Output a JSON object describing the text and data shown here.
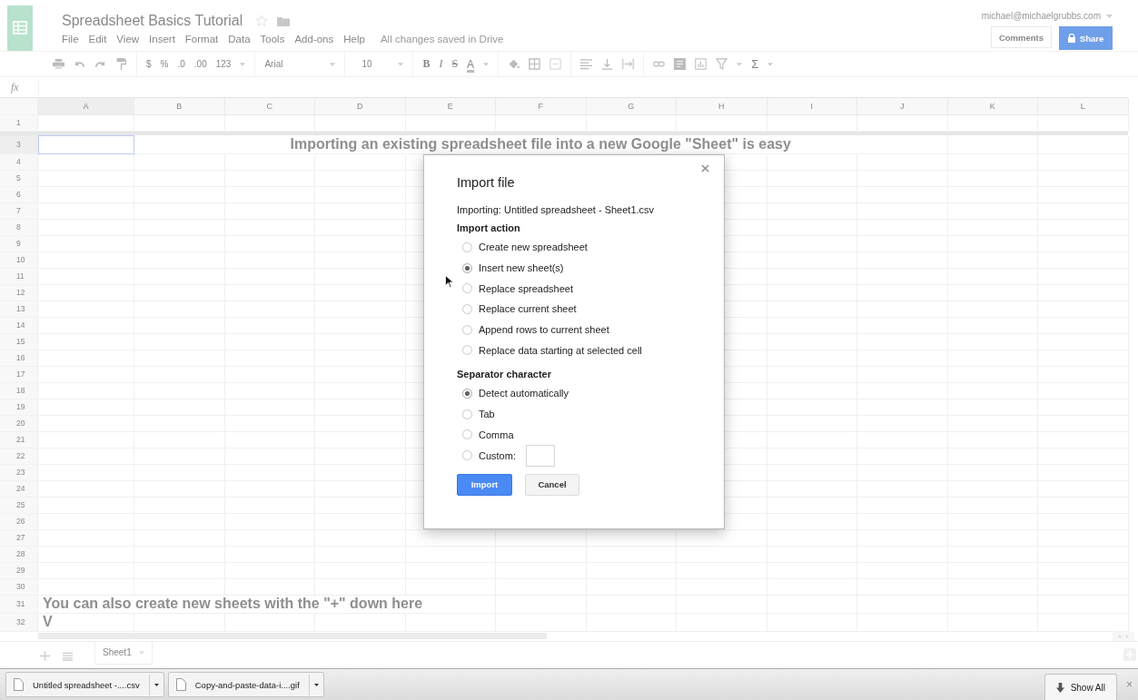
{
  "document": {
    "title": "Spreadsheet Basics Tutorial",
    "menu": [
      "File",
      "Edit",
      "View",
      "Insert",
      "Format",
      "Data",
      "Tools",
      "Add-ons",
      "Help"
    ],
    "save_status": "All changes saved in Drive",
    "account": "michael@michaelgrubbs.com",
    "buttons": [
      "Comments",
      "Share"
    ]
  },
  "toolbar": {
    "number_formats": [
      "$",
      "%",
      ".0",
      ".00",
      "123"
    ],
    "font": "Arial",
    "font_size": "10",
    "text_styles": [
      "B",
      "I",
      "S",
      "A"
    ],
    "function": "Σ"
  },
  "formula_bar": {
    "label": "fx"
  },
  "grid": {
    "columns": [
      {
        "label": "A",
        "selected": true
      },
      {
        "label": "B",
        "selected": false
      },
      {
        "label": "C",
        "selected": false
      },
      {
        "label": "D",
        "selected": false
      },
      {
        "label": "E",
        "selected": false
      },
      {
        "label": "F",
        "selected": false
      },
      {
        "label": "G",
        "selected": false
      },
      {
        "label": "H",
        "selected": false
      },
      {
        "label": "I",
        "selected": false
      },
      {
        "label": "J",
        "selected": false
      },
      {
        "label": "K",
        "selected": false
      },
      {
        "label": "L",
        "selected": false
      }
    ],
    "rows": [
      {
        "number": "1",
        "selected": false,
        "frozen": true
      },
      {
        "number": "3",
        "selected": true,
        "frozen": false,
        "kind": "banner",
        "text": "Importing an existing spreadsheet file into a new Google \"Sheet\" is easy"
      },
      {
        "number": "4",
        "selected": false,
        "frozen": false
      },
      {
        "number": "5",
        "selected": false,
        "frozen": false
      },
      {
        "number": "6",
        "selected": false,
        "frozen": false
      },
      {
        "number": "7",
        "selected": false,
        "frozen": false
      },
      {
        "number": "8",
        "selected": false,
        "frozen": false
      },
      {
        "number": "9",
        "selected": false,
        "frozen": false
      },
      {
        "number": "10",
        "selected": false,
        "frozen": false
      },
      {
        "number": "11",
        "selected": false,
        "frozen": false
      },
      {
        "number": "12",
        "selected": false,
        "frozen": false
      },
      {
        "number": "13",
        "selected": false,
        "frozen": false
      },
      {
        "number": "14",
        "selected": false,
        "frozen": false
      },
      {
        "number": "15",
        "selected": false,
        "frozen": false
      },
      {
        "number": "16",
        "selected": false,
        "frozen": false
      },
      {
        "number": "17",
        "selected": false,
        "frozen": false
      },
      {
        "number": "18",
        "selected": false,
        "frozen": false
      },
      {
        "number": "19",
        "selected": false,
        "frozen": false
      },
      {
        "number": "20",
        "selected": false,
        "frozen": false
      },
      {
        "number": "21",
        "selected": false,
        "frozen": false
      },
      {
        "number": "22",
        "selected": false,
        "frozen": false
      },
      {
        "number": "23",
        "selected": false,
        "frozen": false
      },
      {
        "number": "24",
        "selected": false,
        "frozen": false
      },
      {
        "number": "25",
        "selected": false,
        "frozen": false
      },
      {
        "number": "26",
        "selected": false,
        "frozen": false
      },
      {
        "number": "27",
        "selected": false,
        "frozen": false
      },
      {
        "number": "28",
        "selected": false,
        "frozen": false
      },
      {
        "number": "29",
        "selected": false,
        "frozen": false
      },
      {
        "number": "30",
        "selected": false,
        "frozen": false
      },
      {
        "number": "31",
        "selected": false,
        "frozen": false,
        "kind": "note",
        "text": "You can also create new sheets with the \"+\" down here"
      },
      {
        "number": "32",
        "selected": false,
        "frozen": false,
        "kind": "note",
        "text": "V"
      }
    ]
  },
  "sheet_tabs": [
    {
      "label": "Sheet1",
      "selected": true
    }
  ],
  "downloads": {
    "items": [
      "Untitled spreadsheet -....csv",
      "Copy-and-paste-data-i....gif"
    ],
    "show_all": "Show All",
    "close": "×"
  },
  "dialog": {
    "title": "Import file",
    "file_line": "Importing: Untitled spreadsheet - Sheet1.csv",
    "sections": [
      {
        "heading": "Import action",
        "options": [
          {
            "label": "Create new spreadsheet",
            "selected": false,
            "kind": "plain"
          },
          {
            "label": "Insert new sheet(s)",
            "selected": true,
            "kind": "plain"
          },
          {
            "label": "Replace spreadsheet",
            "selected": false,
            "kind": "plain"
          },
          {
            "label": "Replace current sheet",
            "selected": false,
            "kind": "plain"
          },
          {
            "label": "Append rows to current sheet",
            "selected": false,
            "kind": "plain"
          },
          {
            "label": "Replace data starting at selected cell",
            "selected": false,
            "kind": "plain"
          }
        ]
      },
      {
        "heading": "Separator character",
        "options": [
          {
            "label": "Detect automatically",
            "selected": true,
            "kind": "plain"
          },
          {
            "label": "Tab",
            "selected": false,
            "kind": "plain"
          },
          {
            "label": "Comma",
            "selected": false,
            "kind": "plain"
          },
          {
            "label": "Custom:",
            "selected": false,
            "kind": "custom"
          }
        ]
      }
    ],
    "buttons": [
      {
        "label": "Import",
        "kind": "primary"
      },
      {
        "label": "Cancel",
        "kind": "secondary"
      }
    ]
  }
}
